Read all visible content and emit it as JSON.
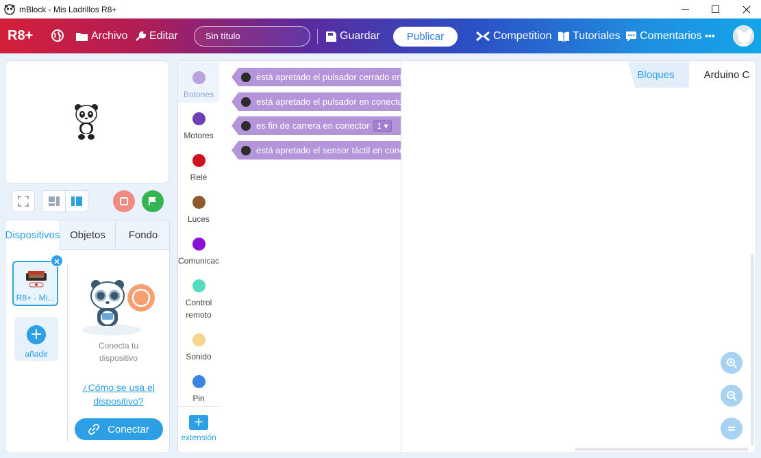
{
  "window": {
    "title": "mBlock - Mis Ladrillos R8+",
    "minimize_label": "—",
    "maximize_label": "☐",
    "close_label": "✕"
  },
  "menubar": {
    "logo": "R8+",
    "archivo": "Archivo",
    "editar": "Editar",
    "project_name": "Sin título",
    "guardar": "Guardar",
    "publicar": "Publicar",
    "competition": "Competition",
    "tutoriales": "Tutoriales",
    "comentarios": "Comentarios",
    "more": "•••"
  },
  "device_panel": {
    "tabs": [
      "Dispositivos",
      "Objetos",
      "Fondo"
    ],
    "active_tab": "Dispositivos",
    "device_label": "R8+ - Mi...",
    "add_label": "añadir",
    "connect_hint_line1": "Conecta tu",
    "connect_hint_line2": "dispositivo",
    "howto_line1": "¿Cómo se usa el",
    "howto_line2": "dispositivo?",
    "connect_button": "Conectar"
  },
  "categories": [
    {
      "label": "Botones",
      "color": "#b9a2dd",
      "active": true
    },
    {
      "label": "Motores",
      "color": "#6c3fb5"
    },
    {
      "label": "Relé",
      "color": "#d0121f"
    },
    {
      "label": "Luces",
      "color": "#8c5a2c"
    },
    {
      "label": "Comunicac",
      "color": "#8a12d6"
    },
    {
      "label": "Control",
      "label2": "remoto",
      "color": "#55dcc0"
    },
    {
      "label": "Sonido",
      "color": "#f8d58a"
    },
    {
      "label": "Pin",
      "color": "#3c84e0"
    }
  ],
  "extension_label": "extensión",
  "blocks": [
    {
      "text": "está apretado el pulsador cerrado en conector"
    },
    {
      "text": "está apretado el pulsador en conector"
    },
    {
      "text": "es fin de carrera en conector",
      "value": "1 ▾"
    },
    {
      "text": "está apretado el sensor táctil en conector"
    }
  ],
  "workspace": {
    "tabs": [
      "Bloques",
      "Arduino C"
    ],
    "active_tab": "Bloques",
    "zoom_in": "+",
    "zoom_out": "−",
    "zoom_reset": "="
  },
  "colors": {
    "accent": "#2d9fe5",
    "block": "#b595d9"
  }
}
